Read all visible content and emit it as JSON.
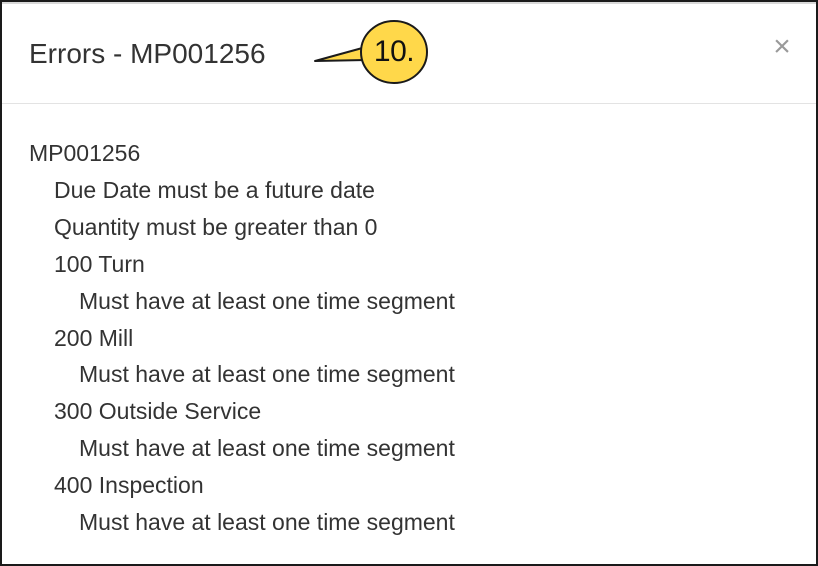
{
  "dialog": {
    "title": "Errors - MP001256",
    "close_glyph": "×",
    "close_icon": "close-icon"
  },
  "callout": {
    "label": "10.",
    "fill_color": "#ffd84a",
    "border_color": "#1a1a1a"
  },
  "errors": {
    "job_id": "MP001256",
    "job_messages": [
      "Due Date must be a future date",
      "Quantity must be greater than 0"
    ],
    "operations": [
      {
        "name": "100 Turn",
        "message": "Must have at least one time segment"
      },
      {
        "name": "200 Mill",
        "message": "Must have at least one time segment"
      },
      {
        "name": "300 Outside Service",
        "message": "Must have at least one time segment"
      },
      {
        "name": "400 Inspection",
        "message": "Must have at least one time segment"
      }
    ]
  }
}
